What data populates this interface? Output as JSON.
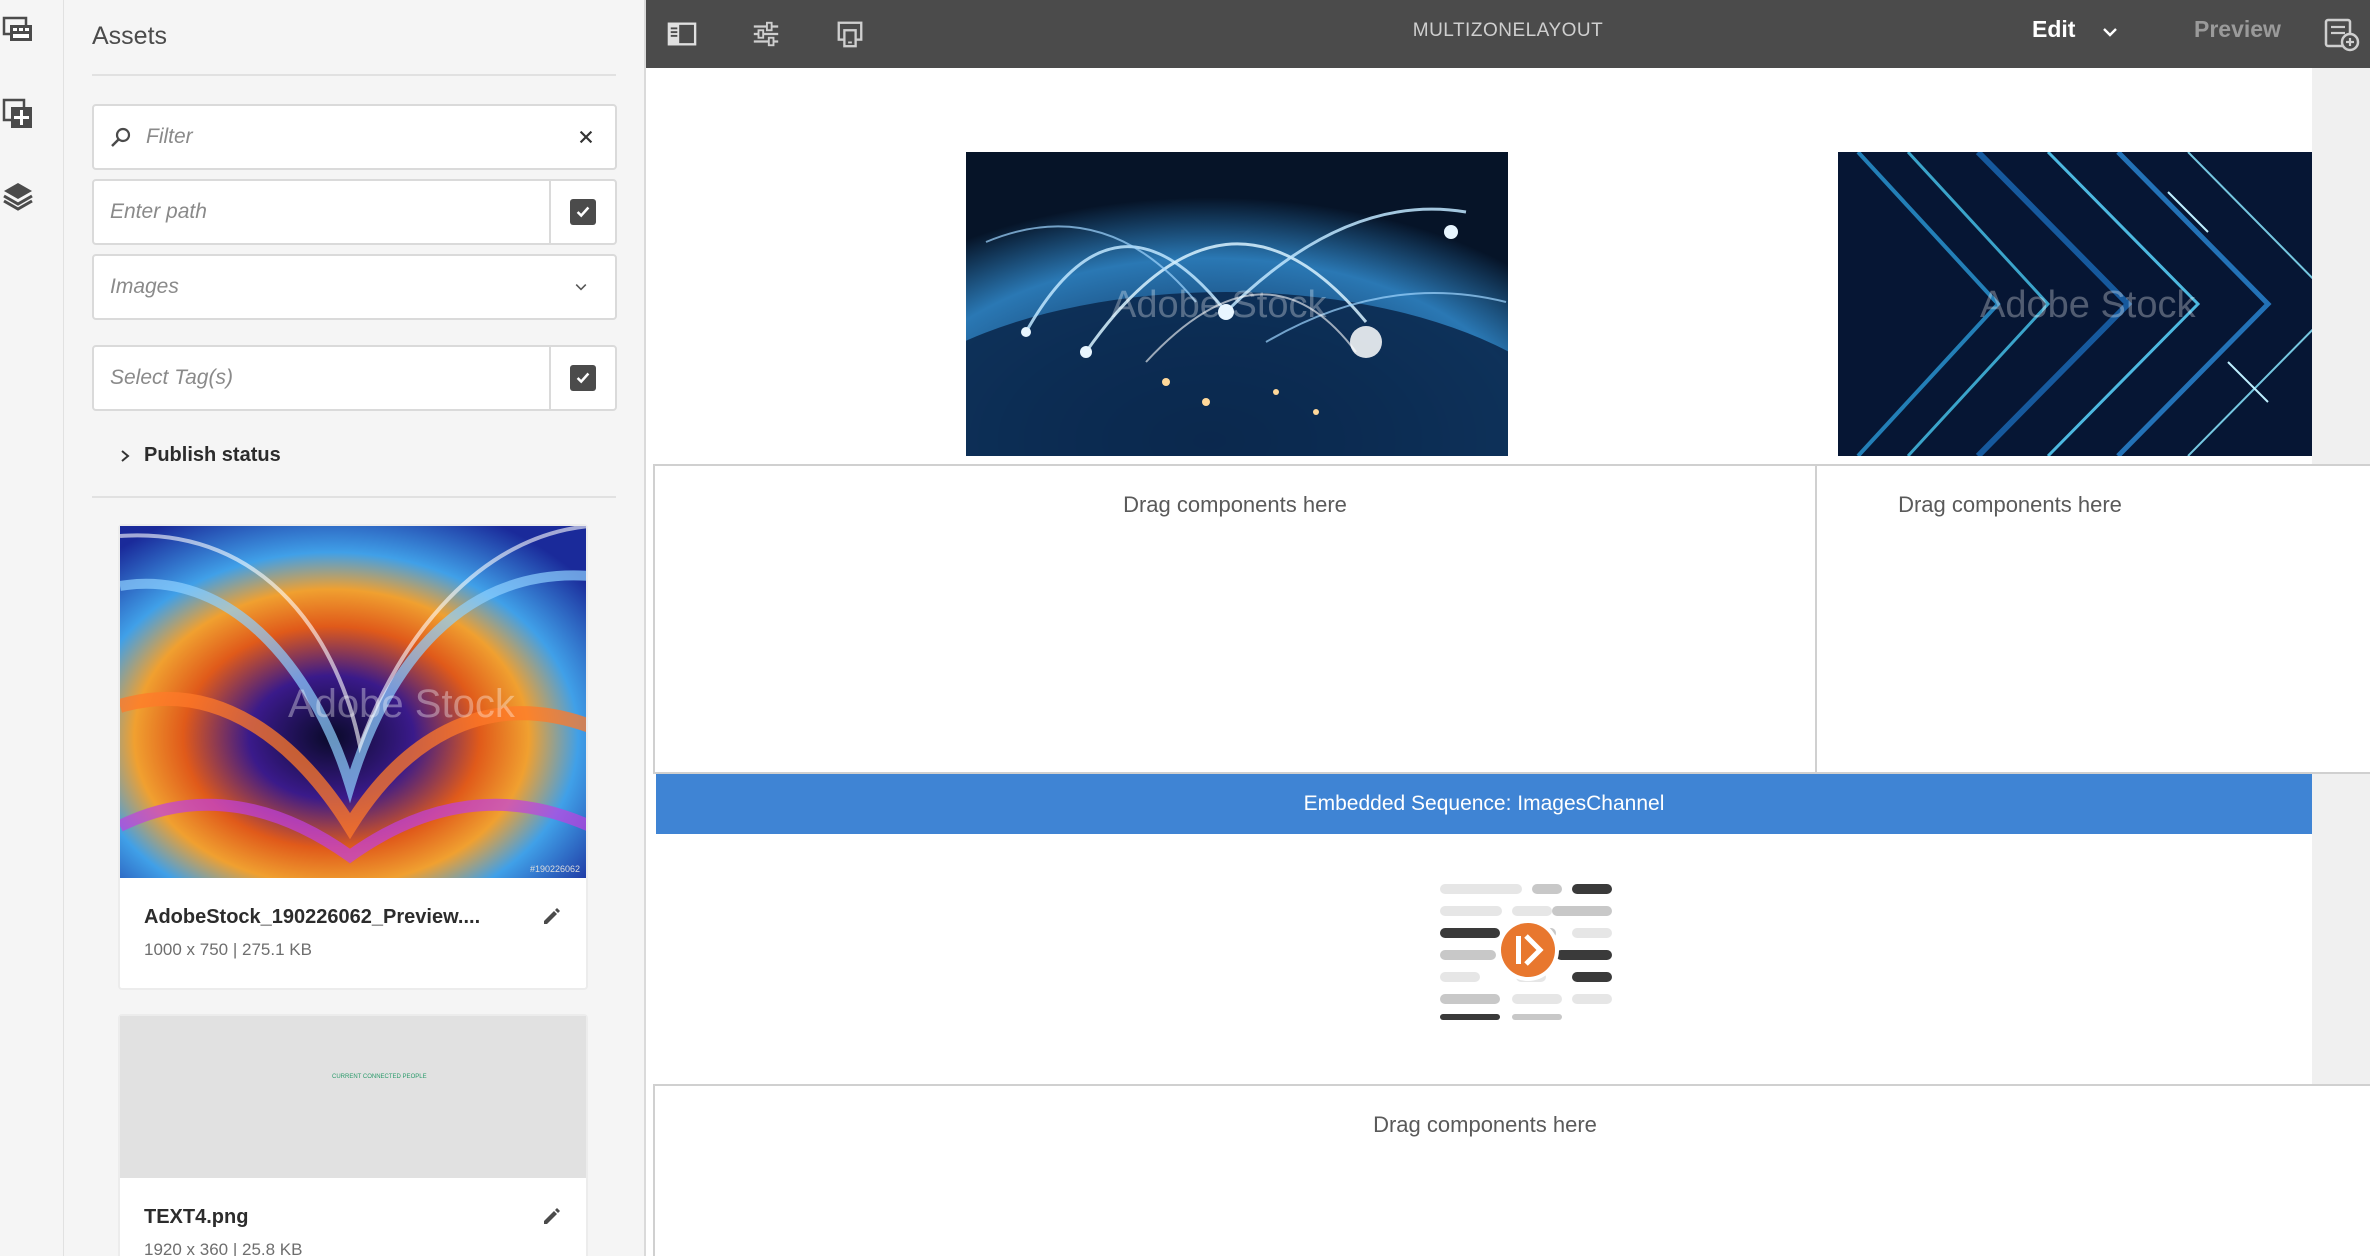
{
  "rail": {
    "items": [
      "filmstrip-icon",
      "add-component-icon",
      "layers-icon"
    ]
  },
  "panel": {
    "title": "Assets",
    "filter_placeholder": "Filter",
    "path_placeholder": "Enter path",
    "type_value": "Images",
    "tags_placeholder": "Select Tag(s)",
    "publish_status_label": "Publish status",
    "assets": [
      {
        "name": "AdobeStock_190226062_Preview....",
        "info": "1000 x 750 | 275.1 KB",
        "watermark": "Adobe Stock",
        "id_label": "#190226062"
      },
      {
        "name": "TEXT4.png",
        "info": "1920 x 360 | 25.8 KB",
        "thumb_text": "CURRENT CONNECTED PEOPLE"
      }
    ]
  },
  "toolbar": {
    "title": "MULTIZONELAYOUT",
    "mode": "Edit",
    "preview": "Preview"
  },
  "canvas": {
    "images": [
      {
        "watermark": "Adobe Stock"
      },
      {
        "watermark": "Adobe Stock"
      }
    ],
    "dropzone_label_1": "Drag components here",
    "dropzone_label_2": "Drag components here",
    "dropzone_label_3": "Drag components here",
    "sequence_label": "Embedded Sequence: ImagesChannel"
  },
  "colors": {
    "toolbar": "#4b4b4b",
    "accent_blue": "#3f84d4",
    "accent_orange": "#e8772e"
  }
}
